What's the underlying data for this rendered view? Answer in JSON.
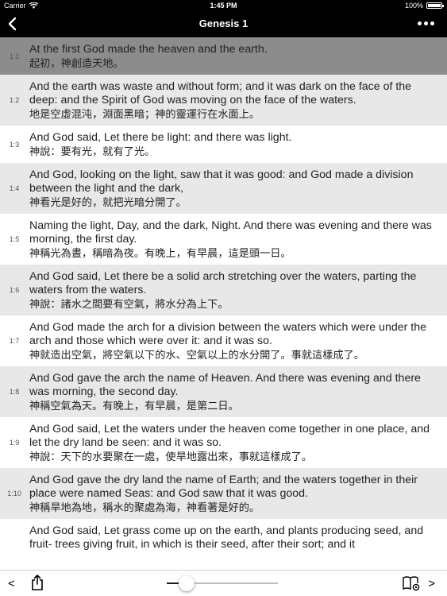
{
  "status": {
    "carrier": "Carrier",
    "time": "1:45 PM",
    "battery": "100%"
  },
  "nav": {
    "title": "Genesis 1"
  },
  "verses": [
    {
      "num": "1:1",
      "en": "At the first God made the heaven and the earth.",
      "zh": "起初，神創造天地。"
    },
    {
      "num": "1:2",
      "en": "And the earth was waste and without form; and it was dark on the face of the deep: and the Spirit of God was moving on the face of the waters.",
      "zh": "地是空虛混沌，淵面黑暗；神的靈運行在水面上。"
    },
    {
      "num": "1:3",
      "en": "And God said, Let there be light: and there was light.",
      "zh": "神說：要有光，就有了光。"
    },
    {
      "num": "1:4",
      "en": "And God, looking on the light, saw that it was good: and God made a division between the light and the dark,",
      "zh": "神看光是好的，就把光暗分開了。"
    },
    {
      "num": "1:5",
      "en": "Naming the light, Day, and the dark, Night. And there was evening and there was morning, the first day.",
      "zh": "神稱光為晝，稱暗為夜。有晚上，有早晨，這是頭一日。"
    },
    {
      "num": "1:6",
      "en": "And God said, Let there be a solid arch stretching over the waters, parting the waters from the waters.",
      "zh": "神說：諸水之間要有空氣，將水分為上下。"
    },
    {
      "num": "1:7",
      "en": "And God made the arch for a division between the waters which were under the arch and those which were over it: and it was so.",
      "zh": "神就造出空氣，將空氣以下的水、空氣以上的水分開了。事就這樣成了。"
    },
    {
      "num": "1:8",
      "en": "And God gave the arch the name of Heaven. And there was evening and there was morning, the second day.",
      "zh": "神稱空氣為天。有晚上，有早晨，是第二日。"
    },
    {
      "num": "1:9",
      "en": "And God said, Let the waters under the heaven come together in one place, and let the dry land be seen: and it was so.",
      "zh": "神說：天下的水要聚在一處，使旱地露出來，事就這樣成了。"
    },
    {
      "num": "1:10",
      "en": "And God gave the dry land the name of Earth; and the waters together in their place were named Seas: and God saw that it was good.",
      "zh": "神稱旱地為地，稱水的聚處為海，神看著是好的。"
    },
    {
      "num": "",
      "en": "And God said, Let grass come up on the earth, and plants producing seed, and fruit- trees giving fruit, in which is their seed, after their sort; and it",
      "zh": ""
    }
  ],
  "toolbar": {
    "prev": "<",
    "next": ">",
    "slider_value": 0.18
  },
  "colors": {
    "highlight": "#8c8c8c",
    "alt_row": "#e8e8e8",
    "bar": "#000000"
  }
}
